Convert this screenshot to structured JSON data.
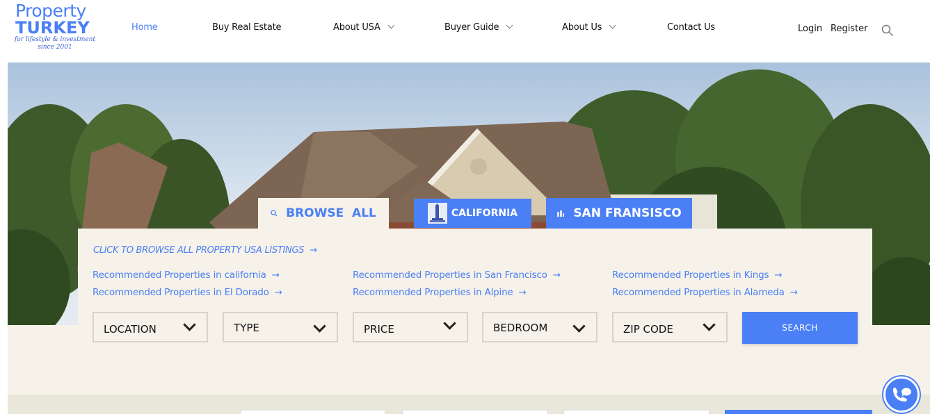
{
  "logo": {
    "line1": "Property",
    "line2": "TURKEY",
    "tagline1": "for lifestyle & investment",
    "tagline2": "since 2001"
  },
  "nav": {
    "home": "Home",
    "buy": "Buy Real Estate",
    "about_usa": "About USA",
    "buyer_guide": "Buyer Guide",
    "about_us": "About Us",
    "contact": "Contact Us"
  },
  "account": {
    "login": "Login",
    "register": "Register"
  },
  "tabs": {
    "browse_all": "BROWSE  ALL",
    "california": "CALIFORNIA",
    "san_fransisco": "SAN FRANSISCO"
  },
  "browse_link": "CLICK TO BROWSE ALL PROPERTY USA LISTINGS",
  "recommended": [
    "Recommended Properties in california",
    "Recommended Properties in El Dorado",
    "Recommended Properties in San Francisco",
    "Recommended Properties in Alpine",
    "Recommended Properties in Kings",
    "Recommended Properties in Alameda"
  ],
  "filters": [
    "LOCATION",
    "TYPE",
    "PRICE",
    "BEDROOM",
    "ZIP CODE"
  ],
  "search_button": "SEARCH",
  "colors": {
    "accent": "#4a7ff5",
    "panel": "#f6f2ea",
    "strip": "#e9e7da"
  }
}
